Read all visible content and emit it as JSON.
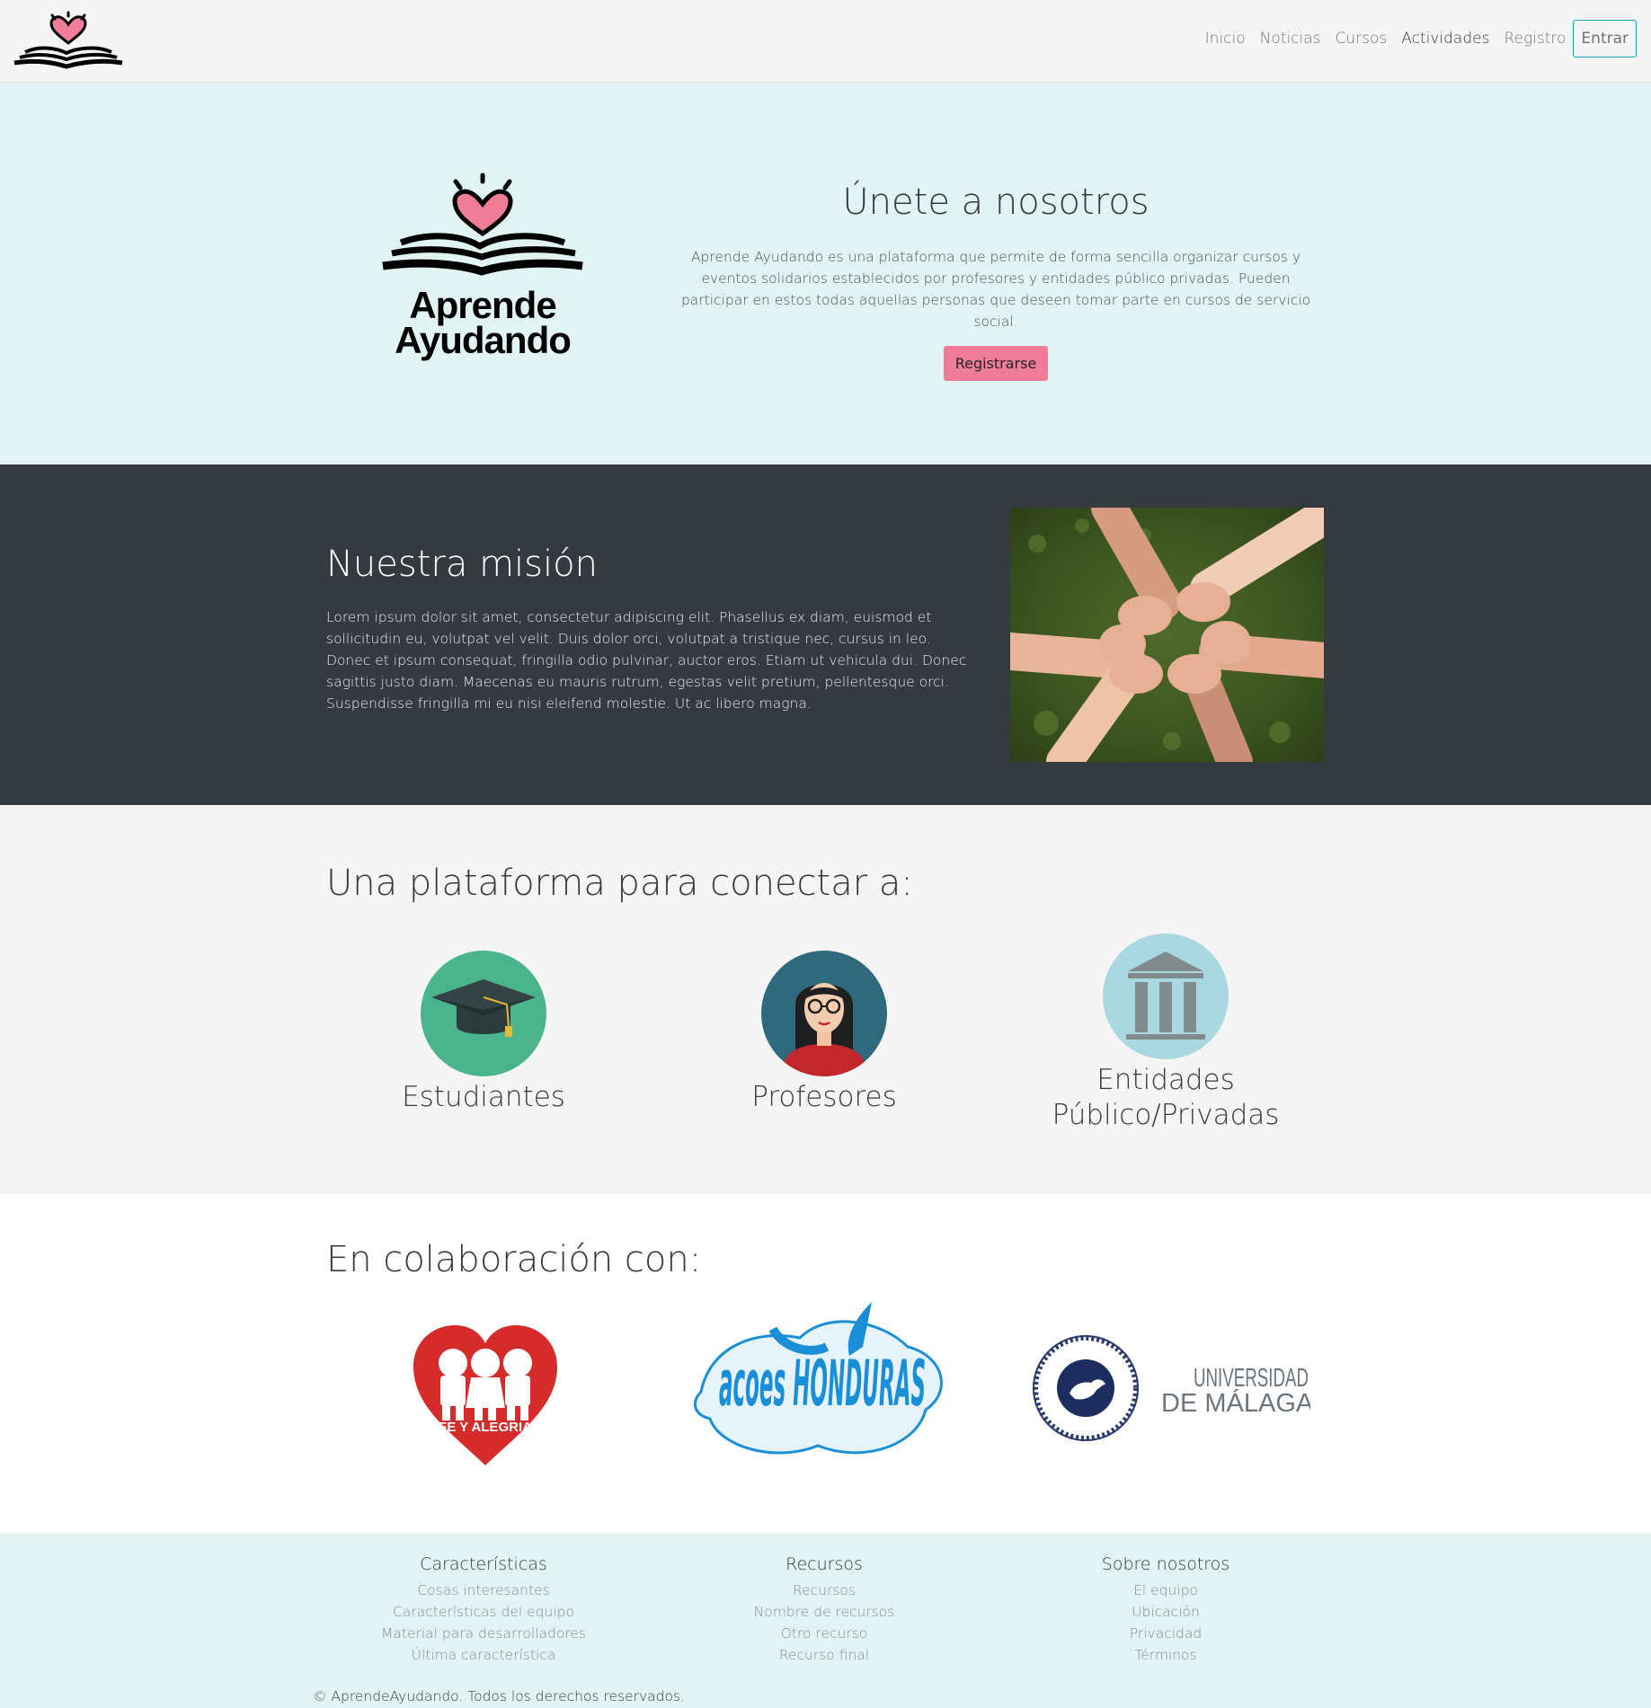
{
  "nav": {
    "logo_icon": "heart-book-icon",
    "links": [
      "Inicio",
      "Noticias",
      "Cursos",
      "Actividades",
      "Registro"
    ],
    "active": "Actividades",
    "login_label": "Entrar"
  },
  "hero": {
    "logo_line1": "Aprende",
    "logo_line2": "Ayudando",
    "title": "Únete a nosotros",
    "text": "Aprende Ayudando es una plataforma que permite de forma sencilla organizar cursos y eventos solidarios establecidos por profesores y entidades público privadas. Pueden participar en estos todas aquellas personas que deseen tomar parte en cursos de servicio social.",
    "button_label": "Registrarse"
  },
  "mission": {
    "title": "Nuestra misión",
    "text": "Lorem ipsum dolor sit amet, consectetur adipiscing elit. Phasellus ex diam, euismod et sollicitudin eu, volutpat vel velit. Duis dolor orci, volutpat a tristique nec, cursus in leo. Donec et ipsum consequat, fringilla odio pulvinar, auctor eros. Etiam ut vehicula dui. Donec sagittis justo diam. Maecenas eu mauris rutrum, egestas velit pretium, pellentesque orci. Suspendisse fringilla mi eu nisi eleifend molestie. Ut ac libero magna.",
    "image": "joined-hands-photo"
  },
  "platform": {
    "title": "Una plataforma para conectar a:",
    "roles": [
      {
        "label": "Estudiantes",
        "icon": "graduation-cap-icon"
      },
      {
        "label": "Profesores",
        "icon": "teacher-avatar-icon"
      },
      {
        "label": "Entidades Público/Privadas",
        "icon": "institution-building-icon"
      }
    ]
  },
  "collab": {
    "title": "En colaboración con:",
    "partners": [
      {
        "name": "FE Y ALEGRIA",
        "logo": "fe-y-alegria-logo"
      },
      {
        "name": "acoes HONDURAS",
        "logo": "acoes-honduras-logo"
      },
      {
        "name": "UNIVERSIDAD DE MÁLAGA",
        "logo": "universidad-malaga-logo",
        "seal_text": "UNIVERSITAS MALACITANA"
      }
    ]
  },
  "footer": {
    "columns": [
      {
        "title": "Características",
        "links": [
          "Cosas interesantes",
          "Características del equipo",
          "Material para desarrolladores",
          "Última característica"
        ]
      },
      {
        "title": "Recursos",
        "links": [
          "Recursos",
          "Nombre de recursos",
          "Otro recurso",
          "Recurso final"
        ]
      },
      {
        "title": "Sobre nosotros",
        "links": [
          "El equipo",
          "Ubicación",
          "Privacidad",
          "Términos"
        ]
      }
    ],
    "copyright": "© AprendeAyudando. Todos los derechos reservados."
  },
  "colors": {
    "accent_pink": "#f07d98",
    "hero_bg": "#e1f3f3",
    "dark_bg": "#343a40",
    "login_border": "#17a2b8"
  }
}
